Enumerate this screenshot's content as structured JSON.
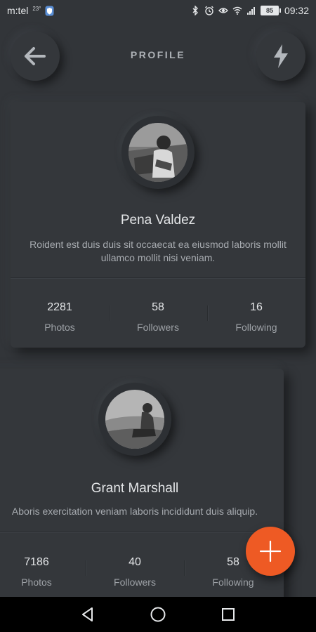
{
  "status_bar": {
    "carrier": "m:tel",
    "carrier_superscript": "23°",
    "battery": "85",
    "time": "09:32"
  },
  "header": {
    "title": "PROFILE",
    "back_icon": "arrow-left-icon",
    "action_icon": "lightning-bolt-icon"
  },
  "profiles": [
    {
      "name": "Pena Valdez",
      "bio": "Roident est duis duis sit occaecat ea eiusmod laboris mollit ullamco mollit nisi veniam.",
      "stats": [
        {
          "value": "2281",
          "label": "Photos"
        },
        {
          "value": "58",
          "label": "Followers"
        },
        {
          "value": "16",
          "label": "Following"
        }
      ]
    },
    {
      "name": "Grant Marshall",
      "bio": "Aboris exercitation veniam laboris incididunt duis aliquip.",
      "stats": [
        {
          "value": "7186",
          "label": "Photos"
        },
        {
          "value": "40",
          "label": "Followers"
        },
        {
          "value": "58",
          "label": "Following"
        }
      ]
    }
  ],
  "fab": {
    "icon": "plus-icon",
    "color": "#ee5a24"
  },
  "colors": {
    "background": "#323539",
    "card": "#34373b",
    "accent": "#ee5a24"
  }
}
